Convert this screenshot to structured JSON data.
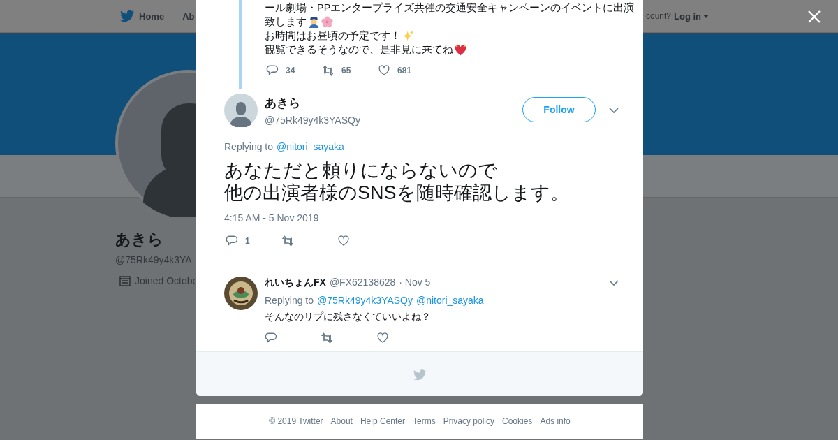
{
  "nav": {
    "items": [
      {
        "label": "Home"
      },
      {
        "label": "Ab"
      }
    ],
    "account_prompt": "count?",
    "login": "Log in"
  },
  "profile": {
    "name": "あきら",
    "handle": "@75Rk49y4k3YA",
    "joined": "Joined Octobe"
  },
  "parent_tweet": {
    "lines": [
      "ール劇場・PPエンタープライズ共催の交通安全キャンペーンのイベントに出演",
      "致します",
      "お時間はお昼頃の予定です！",
      "観覧できるそうなので、是非見に来てね"
    ],
    "actions": [
      {
        "kind": "reply",
        "count": "34"
      },
      {
        "kind": "retweet",
        "count": "65"
      },
      {
        "kind": "like",
        "count": "681"
      }
    ]
  },
  "main_tweet": {
    "name": "あきら",
    "handle": "@75Rk49y4k3YASQy",
    "follow": "Follow",
    "replying_label": "Replying to",
    "replying_to": [
      "@nitori_sayaka"
    ],
    "text": [
      "あなただと頼りにならないので",
      "他の出演者様のSNSを随時確認します。"
    ],
    "time": "4:15 AM - 5 Nov 2019",
    "actions": [
      {
        "kind": "reply",
        "count": "1"
      },
      {
        "kind": "retweet"
      },
      {
        "kind": "like"
      }
    ]
  },
  "reply": {
    "name": "れいちょんFX",
    "handle": "@FX62138628",
    "date": "· Nov 5",
    "replying_label": "Replying to",
    "replying_to": [
      "@75Rk49y4k3YASQy",
      "@nitori_sayaka"
    ],
    "text": "そんなのリプに残さなくていいよね？",
    "actions": [
      {
        "kind": "reply"
      },
      {
        "kind": "retweet"
      },
      {
        "kind": "like"
      }
    ]
  },
  "footer": [
    "© 2019 Twitter",
    "About",
    "Help Center",
    "Terms",
    "Privacy policy",
    "Cookies",
    "Ads info"
  ]
}
